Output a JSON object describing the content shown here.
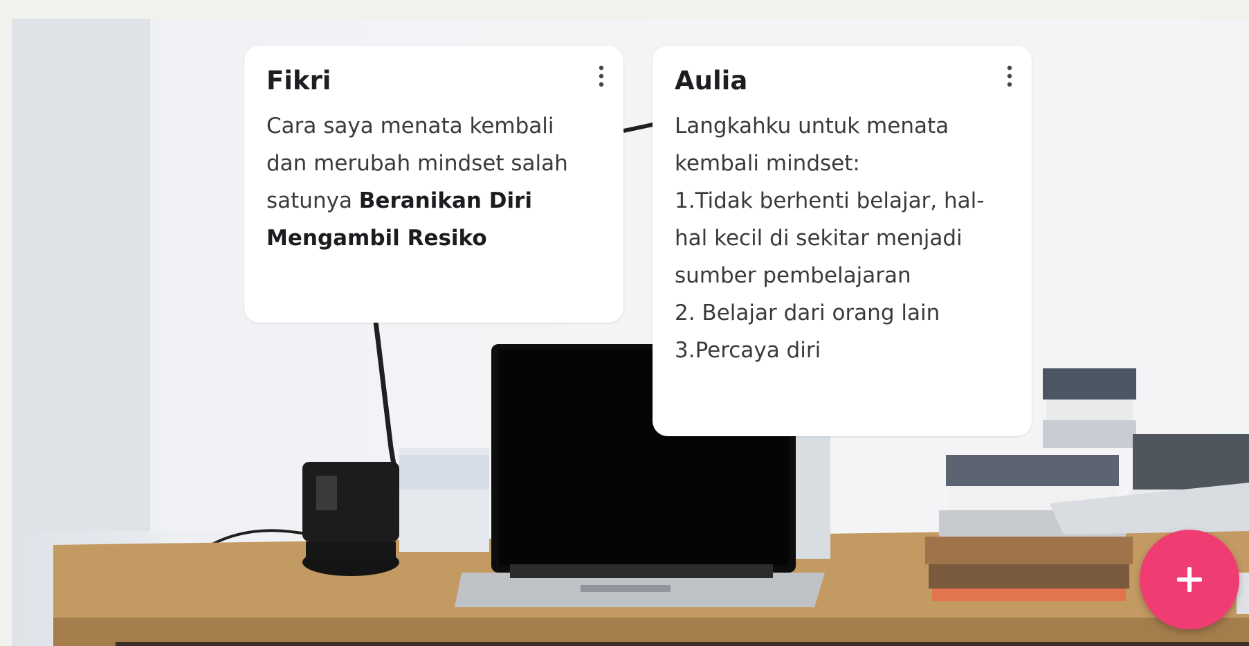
{
  "posts": [
    {
      "author": "Fikri",
      "body": {
        "line1": "Cara saya menata kembali",
        "line2": "dan merubah mindset salah",
        "line3_prefix": "satunya ",
        "line3_bold": "Beranikan Diri",
        "line4_bold": "Mengambil Resiko"
      },
      "menu_icon": "more-vertical-icon"
    },
    {
      "author": "Aulia",
      "body_lines": [
        "Langkahku untuk menata",
        "kembali mindset:",
        "1.Tidak berhenti belajar, hal-",
        "hal kecil di sekitar menjadi",
        "sumber pembelajaran",
        "2. Belajar dari orang lain",
        "3.Percaya diri"
      ],
      "menu_icon": "more-vertical-icon"
    }
  ],
  "fab": {
    "icon": "plus-icon",
    "label": "+",
    "color": "#ef3d73"
  },
  "colors": {
    "card": "#ffffff",
    "author_text": "#1e1e22",
    "body_text": "#3a3a3e",
    "page_bg": "#f1f2ee"
  }
}
